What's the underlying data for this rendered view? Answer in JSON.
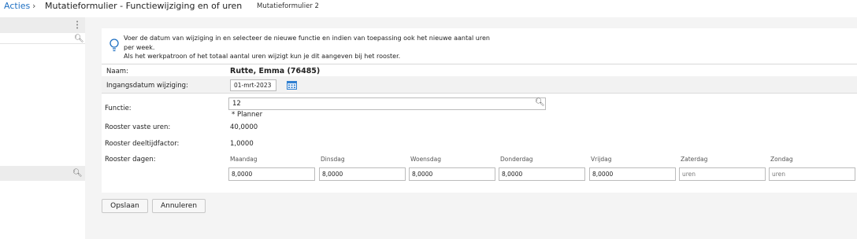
{
  "breadcrumb": {
    "root": "Acties",
    "separator": "›",
    "title": "Mutatieformulier - Functiewijziging en of uren",
    "subtitle": "Mutatieformulier 2"
  },
  "info": {
    "line1": "Voer de datum van wijziging in en selecteer de nieuwe functie en indien van toepassing ook het nieuwe aantal uren",
    "line2": "per week.",
    "line3": "Als het werkpatroon of het totaal aantal uren wijzigt kun je dit aangeven bij het rooster."
  },
  "form": {
    "naam_label": "Naam:",
    "naam_value": "Rutte, Emma (76485)",
    "ingangsdatum_label": "Ingangsdatum wijziging:",
    "ingangsdatum_value": "01-mrt-2023",
    "functie_label": "Functie:",
    "functie_value": "12",
    "functie_desc": "* Planner",
    "vaste_uren_label": "Rooster vaste uren:",
    "vaste_uren_value": "40,0000",
    "deeltijdfactor_label": "Rooster deeltijdfactor:",
    "deeltijdfactor_value": "1,0000",
    "dagen_label": "Rooster dagen:",
    "days": [
      {
        "name": "Maandag",
        "value": "8,0000"
      },
      {
        "name": "Dinsdag",
        "value": "8,0000"
      },
      {
        "name": "Woensdag",
        "value": "8,0000"
      },
      {
        "name": "Donderdag",
        "value": "8,0000"
      },
      {
        "name": "Vrijdag",
        "value": "8,0000"
      },
      {
        "name": "Zaterdag",
        "placeholder": "uren"
      },
      {
        "name": "Zondag",
        "placeholder": "uren"
      }
    ]
  },
  "buttons": {
    "save": "Opslaan",
    "cancel": "Annuleren"
  },
  "colors": {
    "link": "#1e6fc2",
    "panel_bg": "#f4f4f4",
    "row_band": "#f2f2f2"
  },
  "icons": [
    "info-bulb-icon",
    "calendar-icon",
    "search-icon",
    "more-dots-icon"
  ]
}
